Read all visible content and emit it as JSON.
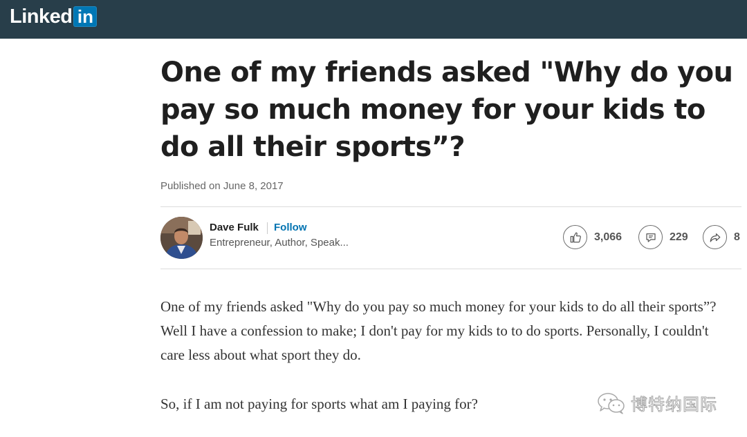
{
  "header": {
    "logo_text": "Linked",
    "logo_box_text": "in",
    "background_color": "#283e4a",
    "brand_color": "#0077b5"
  },
  "article": {
    "title": "One of my friends asked \"Why do you pay so much money for your kids to do all their sports”?",
    "published": "Published on June 8, 2017",
    "author": {
      "name": "Dave Fulk",
      "follow_label": "Follow",
      "headline": "Entrepreneur, Author, Speak..."
    },
    "stats": {
      "likes": "3,066",
      "comments": "229",
      "shares": "8",
      "like_icon": "thumbs-up-icon",
      "comment_icon": "comment-icon",
      "share_icon": "share-arrow-icon"
    },
    "paragraphs": [
      "One of my friends asked \"Why do you pay so much money for your kids to do all their sports”? Well I have a confession to make; I don't pay for my kids to to do sports. Personally, I couldn't care less about what sport they do.",
      "So, if I am not paying for sports what am I paying for?"
    ]
  },
  "watermark": {
    "text": "博特纳国际",
    "icon": "wechat-icon"
  }
}
